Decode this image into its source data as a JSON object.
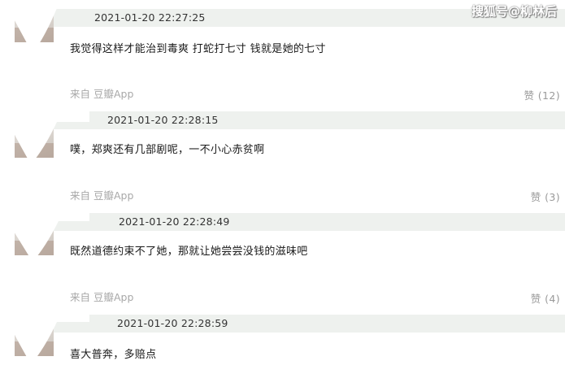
{
  "watermark": "搜狐号@柳林后",
  "comments": [
    {
      "time": "2021-01-20 22:27:25",
      "text": "我觉得这样才能治到毒爽 打蛇打七寸 钱就是她的七寸",
      "source": "来自 豆瓣App",
      "like_label": "赞",
      "like_count": "(12)"
    },
    {
      "time": "2021-01-20 22:28:15",
      "text": "噗，郑爽还有几部剧呢，一不小心赤贫啊",
      "source": "来自 豆瓣App",
      "like_label": "赞",
      "like_count": "(3)"
    },
    {
      "time": "2021-01-20 22:28:49",
      "text": "既然道德约束不了她，那就让她尝尝没钱的滋味吧",
      "source": "来自 豆瓣App",
      "like_label": "赞",
      "like_count": "(4)"
    },
    {
      "time": "2021-01-20 22:28:59",
      "text": "喜大普奔，多赔点"
    }
  ]
}
